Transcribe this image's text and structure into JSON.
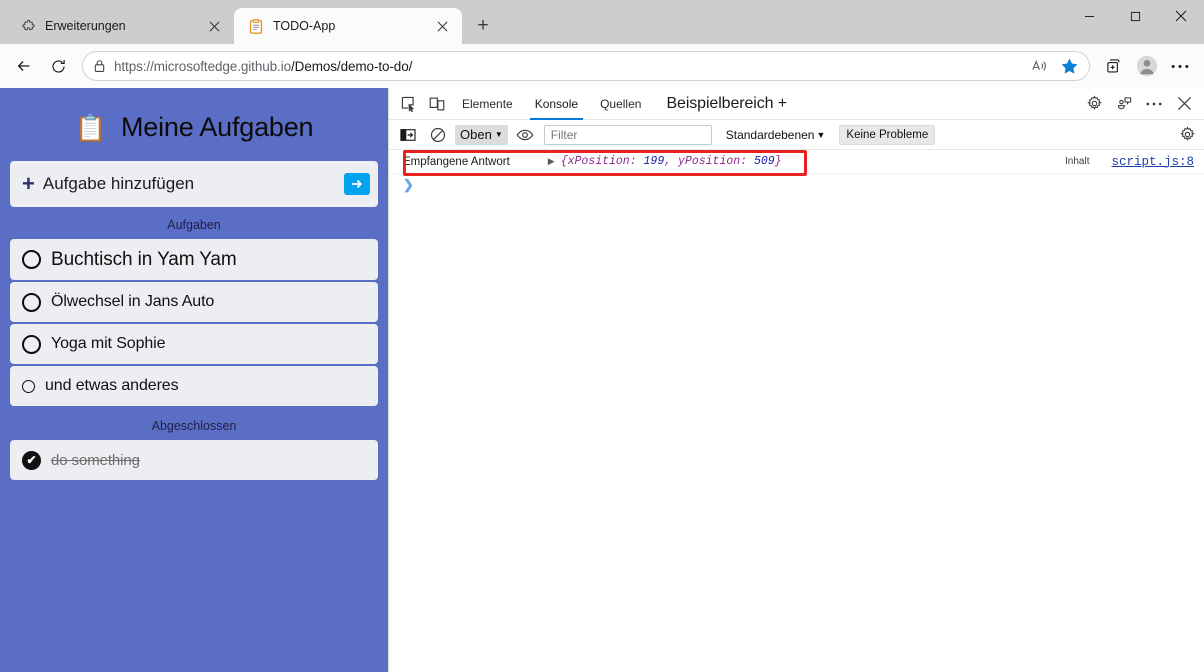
{
  "browser": {
    "tabs": [
      {
        "title": "Erweiterungen",
        "icon": "puzzle-icon",
        "active": false
      },
      {
        "title": "TODO-App",
        "icon": "clipboard-icon",
        "active": true
      }
    ],
    "new_tab_label": "+",
    "window_controls": {
      "minimize": "—",
      "maximize": "□",
      "close": "✕"
    },
    "nav": {
      "back_label": "←",
      "reload_label": "⟳",
      "lock_icon": "lock-icon",
      "url_prefix": "https://microsoftedge.github.io",
      "url_path": "/Demos/demo-to-do/",
      "read_aloud_icon": "read-aloud-icon",
      "favorite_icon": "star-icon",
      "collections_icon": "collections-icon",
      "profile_icon": "profile-avatar-icon",
      "settings_icon": "ellipsis-icon"
    }
  },
  "todo": {
    "emoji": "📋",
    "title": "Meine Aufgaben",
    "add_placeholder": "Aufgabe hinzufügen",
    "plus_label": "+",
    "send_label": "➔",
    "tasks_section_label": "Aufgaben",
    "done_section_label": "Abgeschlossen",
    "tasks": [
      {
        "text": "Buchtisch in Yam Yam",
        "size": "big",
        "done": false
      },
      {
        "text": "Ölwechsel in Jans Auto",
        "size": "medium",
        "done": false
      },
      {
        "text": "Yoga mit Sophie",
        "size": "medium",
        "done": false
      },
      {
        "text": "und etwas anderes",
        "size": "small",
        "done": false
      }
    ],
    "completed": [
      {
        "text": "do something",
        "done": true,
        "check": "✔"
      }
    ],
    "background_color": "#5b6ec5",
    "card_color": "#eceef2",
    "send_button_color": "#00a4ef"
  },
  "devtools": {
    "inspect_icon": "inspect-element-icon",
    "device_icon": "device-toolbar-icon",
    "tabs": [
      {
        "label": "Elemente",
        "selected": false
      },
      {
        "label": "Konsole",
        "selected": true
      },
      {
        "label": "Quellen",
        "selected": false
      }
    ],
    "panel_name": "Beispielbereich +",
    "settings_icon": "gear-icon",
    "feedback_icon": "feedback-icon",
    "more_icon": "ellipsis-icon",
    "close_icon": "close-icon",
    "toolbar": {
      "sidebar_icon": "console-sidebar-icon",
      "clear_icon": "clear-console-icon",
      "context_value": "Oben",
      "context_caret": "▼",
      "eye_icon": "live-expression-icon",
      "filter_placeholder": "Filter",
      "filter_value": "",
      "level_label": "Standardebenen",
      "level_caret": "▼",
      "issues_label": "Keine Probleme",
      "settings_icon": "gear-icon"
    },
    "console": {
      "entries": [
        {
          "label": "Empfangene Antwort",
          "expand_caret": "▶",
          "object_open": "{xPosition: ",
          "x_value": "199",
          "object_mid": ", yPosition: ",
          "y_value": "509",
          "object_close": "}",
          "content_label": "Inhalt",
          "source": "script.js:8",
          "highlighted": true,
          "highlight_color": "#e8231f"
        }
      ],
      "prompt_caret": "❯"
    }
  }
}
